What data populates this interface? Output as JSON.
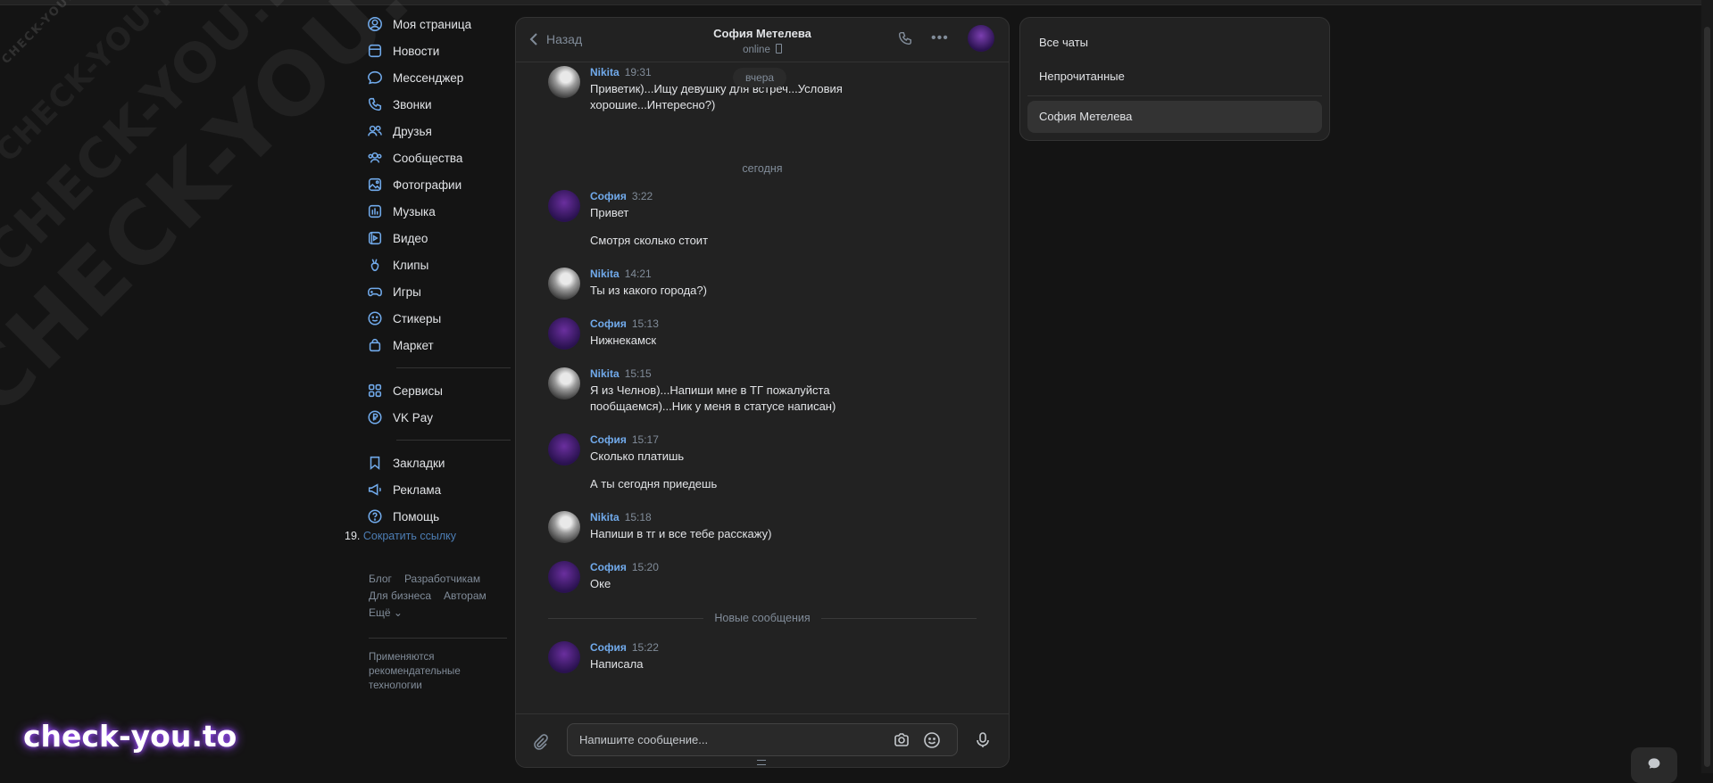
{
  "watermarks": {
    "large": "CHECK-YOU.ME",
    "medium": "CHECK-YOU.ME",
    "small": "CHECK-YOU.ME",
    "tiny": "CHECK-YOU.ME",
    "brand": "check-you.to"
  },
  "nav": {
    "items": [
      {
        "label": "Моя страница",
        "icon": "user-circle-icon"
      },
      {
        "label": "Новости",
        "icon": "news-icon"
      },
      {
        "label": "Мессенджер",
        "icon": "chat-bubble-icon"
      },
      {
        "label": "Звонки",
        "icon": "phone-icon"
      },
      {
        "label": "Друзья",
        "icon": "friends-icon"
      },
      {
        "label": "Сообщества",
        "icon": "communities-icon"
      },
      {
        "label": "Фотографии",
        "icon": "photo-icon"
      },
      {
        "label": "Музыка",
        "icon": "music-icon"
      },
      {
        "label": "Видео",
        "icon": "video-icon"
      },
      {
        "label": "Клипы",
        "icon": "clips-icon"
      },
      {
        "label": "Игры",
        "icon": "gamepad-icon"
      },
      {
        "label": "Стикеры",
        "icon": "sticker-icon"
      },
      {
        "label": "Маркет",
        "icon": "bag-icon"
      }
    ],
    "items2": [
      {
        "label": "Сервисы",
        "icon": "grid-icon"
      },
      {
        "label": "VK Pay",
        "icon": "ruble-icon"
      }
    ],
    "items3": [
      {
        "label": "Закладки",
        "icon": "bookmark-icon"
      },
      {
        "label": "Реклама",
        "icon": "megaphone-icon"
      },
      {
        "label": "Помощь",
        "icon": "help-icon"
      }
    ],
    "shortlink_prefix": "19.",
    "shortlink_label": "Сократить ссылку",
    "footer": {
      "blog": "Блог",
      "developers": "Разработчикам",
      "business": "Для бизнеса",
      "authors": "Авторам",
      "more": "Ещё ⌄",
      "note": "Применяются рекомендательные технологии"
    }
  },
  "chat": {
    "back_label": "Назад",
    "name": "София Метелева",
    "status": "online",
    "day_yesterday": "вчера",
    "day_today": "сегодня",
    "new_messages": "Новые сообщения",
    "input_placeholder": "Напишите сообщение...",
    "messages": [
      {
        "author": "Nikita",
        "time": "19:31",
        "text": "Приветик)...Ищу девушку для встреч...Условия хорошие...Интересно?)"
      },
      {
        "author": "София",
        "time": "3:22",
        "text": "Привет",
        "text2": "Смотря сколько стоит"
      },
      {
        "author": "Nikita",
        "time": "14:21",
        "text": "Ты из какого города?)"
      },
      {
        "author": "София",
        "time": "15:13",
        "text": "Нижнекамск"
      },
      {
        "author": "Nikita",
        "time": "15:15",
        "text": "Я из Челнов)...Напиши мне в ТГ пожалуйста пообщаемся)...Ник у меня в статусе написан)"
      },
      {
        "author": "София",
        "time": "15:17",
        "text": "Сколько платишь",
        "text2": "А ты сегодня приедешь"
      },
      {
        "author": "Nikita",
        "time": "15:18",
        "text": "Напиши в тг и все тебе расскажу)"
      },
      {
        "author": "София",
        "time": "15:20",
        "text": "Оке"
      },
      {
        "author": "София",
        "time": "15:22",
        "text": "Написала"
      }
    ]
  },
  "filters": {
    "all": "Все чаты",
    "unread": "Непрочитанные",
    "contact": "София Метелева"
  },
  "colors": {
    "accent": "#71aaeb",
    "background": "#141414",
    "panel": "#222222"
  }
}
